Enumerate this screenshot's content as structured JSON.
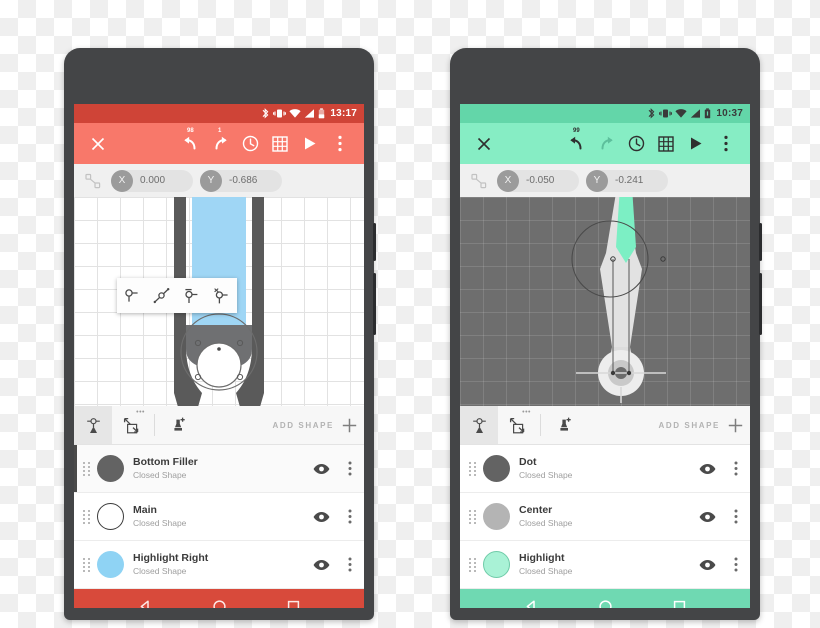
{
  "background": {
    "type": "transparency-checkerboard"
  },
  "phones": [
    {
      "id": "phone-left",
      "accent": "#F8786A",
      "accent_dark": "#CF4437",
      "statusbar": {
        "time": "13:17",
        "icons": [
          "bluetooth-icon",
          "vibrate-icon",
          "wifi-icon",
          "signal-icon",
          "battery-icon"
        ]
      },
      "appbar": {
        "close_label": "✕",
        "undo_badge": "98",
        "redo_badge": "1",
        "actions": [
          "close-icon",
          "undo-icon",
          "redo-icon",
          "history-icon",
          "grid-icon",
          "play-icon",
          "overflow-icon"
        ]
      },
      "coordbar": {
        "link_icon": "link-nodes-icon",
        "x_label": "X",
        "x_value": "0.000",
        "y_label": "Y",
        "y_value": "-0.686"
      },
      "canvas": {
        "theme": "light",
        "background": "#ffffff",
        "grid": true,
        "shape_fill": "#9FD6F5",
        "shape_stroke": "#5A5A5A",
        "node_toolbar": [
          "node-corner-icon",
          "node-smooth-icon",
          "node-symmetric-icon",
          "node-delete-icon"
        ]
      },
      "shapetools": {
        "tools": [
          "select-node-tool",
          "transform-tool",
          "pen-tool"
        ],
        "active_tool": "select-node-tool",
        "add_shape_label": "ADD SHAPE",
        "add_icon": "plus-icon"
      },
      "layers": [
        {
          "name": "Bottom Filler",
          "type": "Closed Shape",
          "color": "#636363",
          "stroke": "none",
          "selected": true
        },
        {
          "name": "Main",
          "type": "Closed Shape",
          "color": "#ffffff",
          "stroke": "#3b3b3b",
          "selected": false
        },
        {
          "name": "Highlight Right",
          "type": "Closed Shape",
          "color": "#8FD3F4",
          "stroke": "none",
          "selected": false
        }
      ],
      "navbar": {
        "buttons": [
          "back-icon",
          "home-icon",
          "recents-icon"
        ]
      }
    },
    {
      "id": "phone-right",
      "accent": "#86EDC4",
      "accent_dark": "#63D6A9",
      "statusbar": {
        "time": "10:37",
        "icons": [
          "bluetooth-icon",
          "vibrate-icon",
          "wifi-icon",
          "signal-icon",
          "battery-icon"
        ]
      },
      "appbar": {
        "close_label": "✕",
        "undo_badge": "99",
        "redo_badge": "",
        "actions": [
          "close-icon",
          "undo-icon",
          "redo-icon",
          "history-icon",
          "grid-icon",
          "play-icon",
          "overflow-icon"
        ]
      },
      "coordbar": {
        "link_icon": "link-nodes-icon",
        "x_label": "X",
        "x_value": "-0.050",
        "y_label": "Y",
        "y_value": "-0.241"
      },
      "canvas": {
        "theme": "dark",
        "background": "#6e6e6e",
        "grid": true,
        "shape_fill": "#7CEFC4",
        "shape_stroke": "#E3E3E3",
        "node_toolbar": []
      },
      "shapetools": {
        "tools": [
          "select-node-tool",
          "transform-tool",
          "pen-tool"
        ],
        "active_tool": "select-node-tool",
        "add_shape_label": "ADD SHAPE",
        "add_icon": "plus-icon"
      },
      "layers": [
        {
          "name": "Dot",
          "type": "Closed Shape",
          "color": "#636363",
          "stroke": "none",
          "selected": false
        },
        {
          "name": "Center",
          "type": "Closed Shape",
          "color": "#B4B4B4",
          "stroke": "none",
          "selected": false
        },
        {
          "name": "Highlight",
          "type": "Closed Shape",
          "color": "#A9F2D6",
          "stroke": "#6FCBA8",
          "selected": false
        }
      ],
      "navbar": {
        "buttons": [
          "back-icon",
          "home-icon",
          "recents-icon"
        ]
      }
    }
  ]
}
